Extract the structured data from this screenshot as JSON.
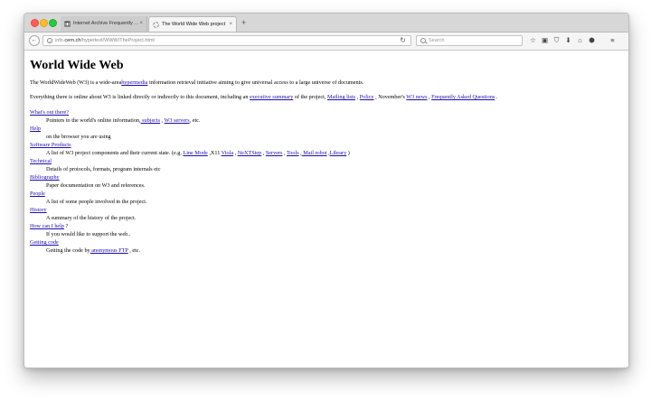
{
  "window": {
    "tabs": [
      {
        "title": "Internet Archive Frequently ...",
        "close": "×"
      },
      {
        "title": "The World Wide Web project",
        "close": "×"
      }
    ],
    "new_tab_label": "+",
    "url": {
      "scheme_prefix": "info.",
      "host": "cern.ch",
      "path": "/hypertext/WWW/TheProject.html"
    },
    "search_placeholder": "Search"
  },
  "icons": {
    "back": "back-arrow-icon",
    "info": "info-icon",
    "reload": "reload-icon",
    "search": "search-icon",
    "toolbar": [
      "star-icon",
      "reading-list-icon",
      "pocket-icon",
      "download-icon",
      "home-icon",
      "shield-icon",
      "menu-icon"
    ]
  },
  "glyphs": {
    "back": "←",
    "info": "i",
    "reload": "↻",
    "toolbar": [
      "☆",
      "▣",
      "⛉",
      "⬇",
      "⌂",
      "⬢",
      "≡"
    ]
  },
  "colors": {
    "link": "#1a0dab",
    "active_tab": "#f5f5f5",
    "tab_strip": "#d7d7d7"
  },
  "page": {
    "title": "World Wide Web",
    "intro": {
      "before": "The WorldWideWeb (W3) is a wide-area",
      "link": "hypermedia",
      "after": " information retrieval initiative aiming to give universal access to a large universe of documents."
    },
    "everything": {
      "before": "Everything there is online about W3 is linked directly or indirectly to this document, including an ",
      "link1": "executive summary",
      "mid1": " of the project, ",
      "link2": "Mailing lists",
      "mid2": " , ",
      "link3": "Policy",
      "mid3": " , November's ",
      "link4": "W3 news",
      "mid4": " , ",
      "link5": "Frequently Asked Questions",
      "after": " ."
    },
    "sections": {
      "whats_out_there": {
        "title": "What's out there?",
        "desc_before": "Pointers to the world's online information,",
        "link1": " subjects",
        "mid": " , ",
        "link2": "W3 servers",
        "after": ", etc."
      },
      "help": {
        "title": "Help",
        "desc": "on the browser you are using"
      },
      "software": {
        "title": "Software Products",
        "desc_before": "A list of W3 project components and their current state. (e.g. ",
        "link1": "Line Mode",
        "mid1": " ,X11 ",
        "link2": "Viola",
        "mid2": " , ",
        "link3": "NeXTStep",
        "mid3": " , ",
        "link4": "Servers",
        "mid4": " , ",
        "link5": "Tools",
        "mid5": " ,",
        "link6": " Mail robot",
        "mid6": " ,",
        "link7": "Library",
        "after": " )"
      },
      "technical": {
        "title": "Technical",
        "desc": "Details of protocols, formats, program internals etc"
      },
      "bibliography": {
        "title": "Bibliography",
        "desc": "Paper documentation on W3 and references."
      },
      "people": {
        "title": "People",
        "desc": "A list of some people involved in the project."
      },
      "history": {
        "title": "History",
        "desc": "A summary of the history of the project."
      },
      "how_can_i_help": {
        "title": "How can I help",
        "after": " ?",
        "desc": "If you would like to support the web.."
      },
      "getting_code": {
        "title": "Getting code",
        "desc_before": "Getting the code by",
        "link": " anonymous FTP",
        "after": " , etc."
      }
    }
  }
}
